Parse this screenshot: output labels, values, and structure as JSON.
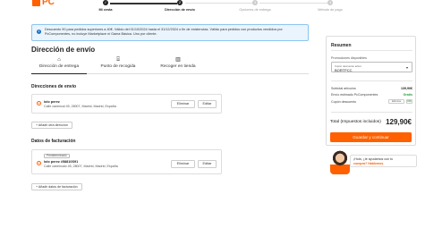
{
  "brand": {
    "logo_text": "PC",
    "accent": "#ff6000"
  },
  "steps": [
    {
      "number": "1",
      "label": "Mi cesta",
      "state": "done"
    },
    {
      "number": "2",
      "label": "Dirección de envío",
      "state": "active"
    },
    {
      "number": "3",
      "label": "Opciones de entrega",
      "state": "todo"
    },
    {
      "number": "4",
      "label": "Método de pago",
      "state": "todo"
    }
  ],
  "banner": {
    "text": "Descuento 90 para pedidos superiores a 40€. Válido del 01/10/2024 hasta el 31/12/2024 o fin de existencias. Válido para pedidos con productos vendidos por PcComponentes, no incluye Marketplace ni Gama Básica. Uno por cliente."
  },
  "page_title": "Dirección de envío",
  "tabs": [
    {
      "icon": "home-icon",
      "label": "Dirección de entrega",
      "active": true
    },
    {
      "icon": "store-icon",
      "label": "Punto de recogida",
      "active": false
    },
    {
      "icon": "shop-icon",
      "label": "Recoger en tienda",
      "active": false
    }
  ],
  "shipping": {
    "section_title": "Direcciones de envío",
    "address": {
      "name": "lolo perez",
      "line": "Calle canencal 45, 28007, Madrid, Madrid, España"
    },
    "delete_label": "Eliminar",
    "edit_label": "Editar",
    "add_label": "+ Añadir otra dirección"
  },
  "billing": {
    "section_title": "Datos de facturación",
    "badge": "Predeterminado",
    "address": {
      "name": "lolo perez #58810S91",
      "line": "Calle canencalo 45, 28007, Madrid, Madrid, España"
    },
    "delete_label": "Eliminar",
    "edit_label": "Editar",
    "add_label": "+ Añadir datos de facturación"
  },
  "summary": {
    "title": "Resumen",
    "promo_label": "Promociones disponibles",
    "promo_select_label": "Cupón descuento activo",
    "promo_select_value": "BORTPCC",
    "rows": [
      {
        "label": "Subtotal artículos",
        "value": "139,90€",
        "style": "bold"
      },
      {
        "label": "Envío estimado PcComponentes",
        "value": "Gratis",
        "style": "green"
      }
    ],
    "coupon_label": "Cupón descuento",
    "coupon_input": "Elimina",
    "coupon_ok": "OK",
    "total_label": "Total (Impuestos incluidos)",
    "total_value": "129,90€",
    "cta_label": "Guardar y continuar"
  },
  "help": {
    "line1": "¡Hola, ¿te ayudamos con tu",
    "link_text": "compra?",
    "line2_rest": "Hablemos"
  }
}
